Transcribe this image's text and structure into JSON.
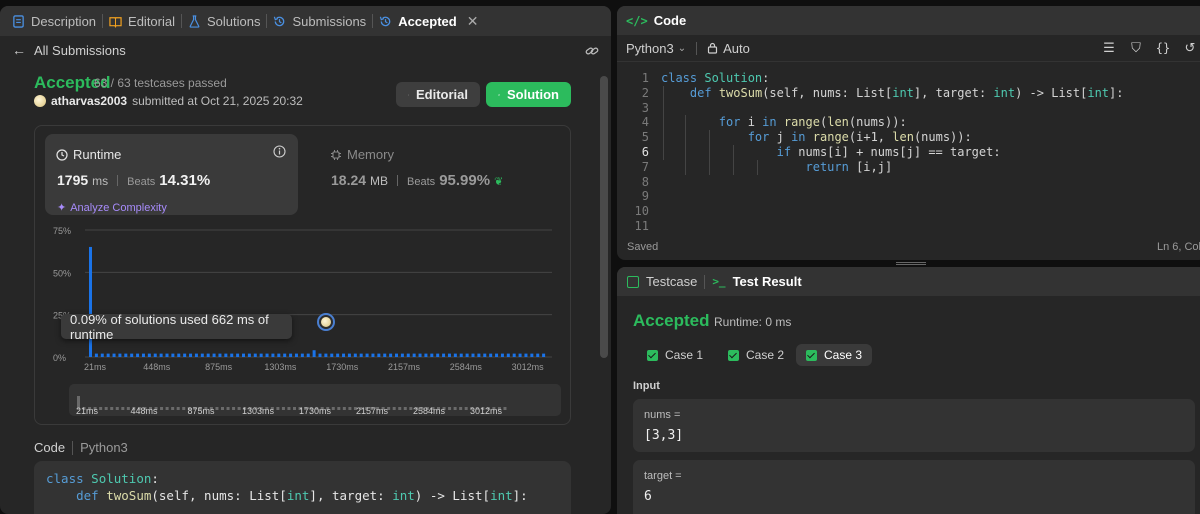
{
  "left_tabs": [
    {
      "label": "Description"
    },
    {
      "label": "Editorial"
    },
    {
      "label": "Solutions"
    },
    {
      "label": "Submissions"
    },
    {
      "label": "Accepted"
    }
  ],
  "back_link": "All Submissions",
  "submission": {
    "status": "Accepted",
    "testcases": "63 / 63 testcases passed",
    "username": "atharvas2003",
    "submitted_text": "submitted at Oct 21, 2025 20:32"
  },
  "buttons": {
    "editorial": "Editorial",
    "solution": "Solution"
  },
  "runtime": {
    "title": "Runtime",
    "value": "1795",
    "unit": "ms",
    "beats_label": "Beats",
    "beats_pct": "14.31%",
    "analyze": "Analyze Complexity"
  },
  "memory": {
    "title": "Memory",
    "value": "18.24",
    "unit": "MB",
    "beats_label": "Beats",
    "beats_pct": "95.99%"
  },
  "chart_data": {
    "type": "bar",
    "y_ticks": [
      "75%",
      "50%",
      "25%",
      "0%"
    ],
    "ylim": [
      0,
      75
    ],
    "x_ticks": [
      "21ms",
      "448ms",
      "875ms",
      "1303ms",
      "1730ms",
      "2157ms",
      "2584ms",
      "3012ms"
    ],
    "series": [
      {
        "values": [
          65,
          2,
          2,
          2,
          2,
          2,
          2,
          2,
          2,
          2,
          2,
          2,
          2,
          2,
          2,
          2,
          2,
          2,
          2,
          2,
          2,
          2,
          2,
          2,
          2,
          2,
          2,
          2,
          2,
          2,
          2,
          2,
          2,
          2,
          2,
          2,
          2,
          2,
          2,
          2,
          2,
          2,
          2,
          2,
          2,
          2,
          2,
          2,
          2,
          2,
          2,
          2,
          2,
          2,
          2,
          2,
          2,
          2,
          2,
          2,
          2,
          2,
          2,
          2,
          2,
          2,
          2,
          2,
          2,
          2,
          2,
          2,
          2,
          2,
          2,
          2,
          2,
          2
        ]
      }
    ],
    "highlight_index": 38,
    "highlight_value": 4,
    "tooltip": "0.09% of solutions used 662 ms of runtime",
    "minimap_ticks": [
      "21ms",
      "448ms",
      "875ms",
      "1303ms",
      "1730ms",
      "2157ms",
      "2584ms",
      "3012ms"
    ],
    "color": "#1a73e8"
  },
  "code_section": {
    "label": "Code",
    "lang": "Python3"
  },
  "code_preview": [
    "class Solution:",
    "    def twoSum(self, nums: List[int], target: int) -> List[int]:"
  ],
  "editor": {
    "title": "Code",
    "language": "Python3",
    "mode": "Auto",
    "status_left": "Saved",
    "status_right": "Ln 6, Col",
    "lines": [
      {
        "n": "1",
        "text": "class Solution:"
      },
      {
        "n": "2",
        "text": "    def twoSum(self, nums: List[int], target: int) -> List[int]:"
      },
      {
        "n": "3",
        "text": ""
      },
      {
        "n": "4",
        "text": "        for i in range(len(nums)):"
      },
      {
        "n": "5",
        "text": "            for j in range(i+1, len(nums)):"
      },
      {
        "n": "6",
        "text": "                if nums[i] + nums[j] == target:"
      },
      {
        "n": "7",
        "text": "                    return [i,j]"
      },
      {
        "n": "8",
        "text": ""
      },
      {
        "n": "9",
        "text": ""
      },
      {
        "n": "10",
        "text": ""
      },
      {
        "n": "11",
        "text": ""
      }
    ]
  },
  "test_panel": {
    "tab_testcase": "Testcase",
    "tab_result": "Test Result",
    "status": "Accepted",
    "runtime": "Runtime: 0 ms",
    "cases": [
      "Case 1",
      "Case 2",
      "Case 3"
    ],
    "input_label": "Input",
    "fields": [
      {
        "name": "nums =",
        "value": "[3,3]"
      },
      {
        "name": "target =",
        "value": "6"
      }
    ]
  }
}
